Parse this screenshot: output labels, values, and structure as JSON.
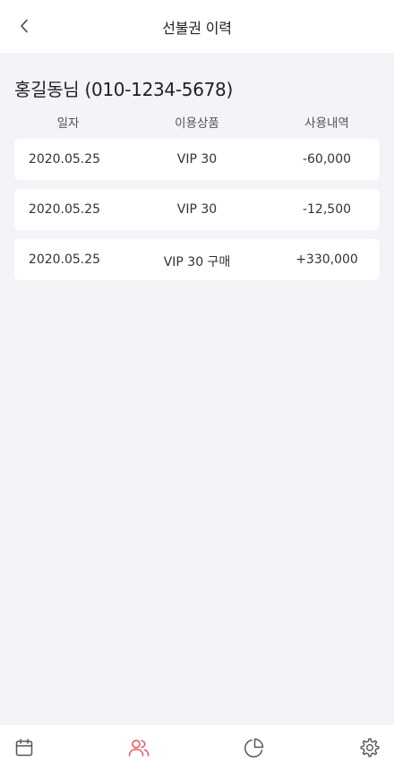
{
  "header": {
    "title": "선불권 이력",
    "back_icon": "chevron-left-icon"
  },
  "customer": {
    "label": "홍길동님 (010-1234-5678)"
  },
  "columns": {
    "date": "일자",
    "product": "이용상품",
    "amount": "사용내역"
  },
  "rows": [
    {
      "date": "2020.05.25",
      "product": "VIP 30",
      "amount": "-60,000"
    },
    {
      "date": "2020.05.25",
      "product": "VIP 30",
      "amount": "-12,500"
    },
    {
      "date": "2020.05.25",
      "product": "VIP 30 구매",
      "amount": "+330,000"
    }
  ],
  "bottom_nav": {
    "items": [
      {
        "icon": "calendar-icon",
        "active": false
      },
      {
        "icon": "users-icon",
        "active": true
      },
      {
        "icon": "pie-chart-icon",
        "active": false
      },
      {
        "icon": "settings-icon",
        "active": false
      }
    ],
    "active_color": "#e4545a",
    "inactive_color": "#555555"
  }
}
